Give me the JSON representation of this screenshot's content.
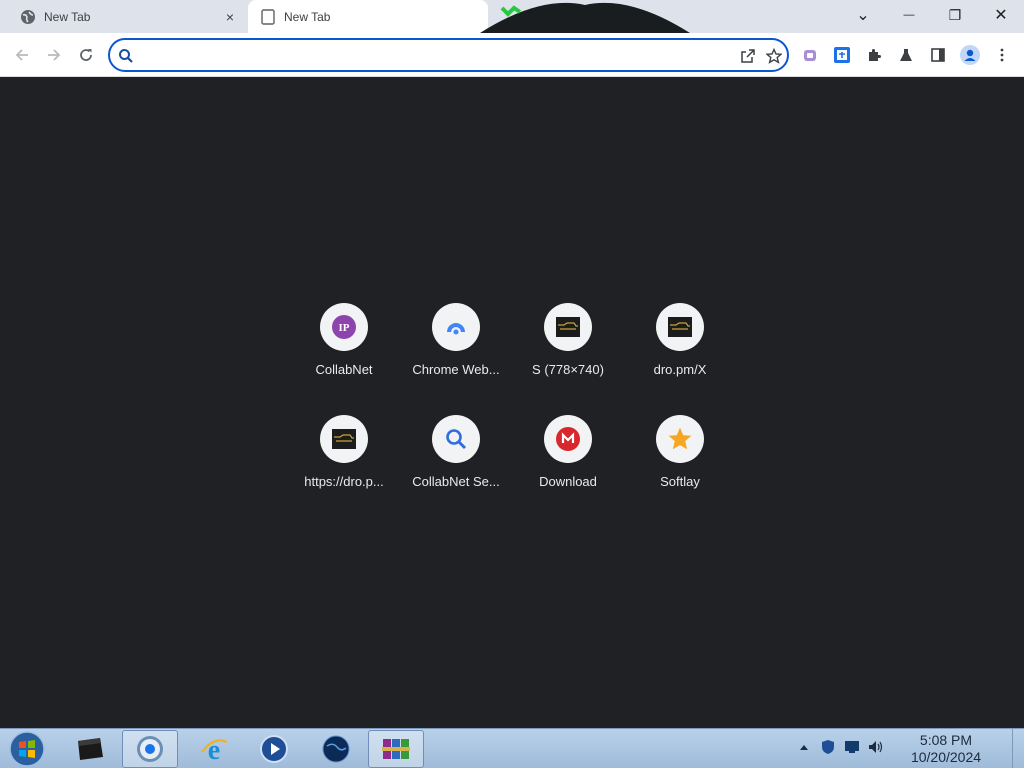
{
  "tabs": [
    {
      "title": "New Tab",
      "active": false
    },
    {
      "title": "New Tab",
      "active": true
    }
  ],
  "tab_close_glyph": "×",
  "window_controls": {
    "tab_search": "⌄",
    "minimize": "—",
    "restore": "❐",
    "close": "✕"
  },
  "omnibox": {
    "value": "",
    "placeholder": ""
  },
  "shortcuts": [
    {
      "label": "CollabNet",
      "icon": "ip-logo-icon"
    },
    {
      "label": "Chrome Web...",
      "icon": "chrome-webstore-icon"
    },
    {
      "label": "S (778×740)",
      "icon": "site-thumbnail-icon"
    },
    {
      "label": "dro.pm/X",
      "icon": "site-thumbnail-icon"
    },
    {
      "label": "https://dro.p...",
      "icon": "site-thumbnail-icon"
    },
    {
      "label": "CollabNet Se...",
      "icon": "search-icon"
    },
    {
      "label": "Download",
      "icon": "mega-icon"
    },
    {
      "label": "Softlay",
      "icon": "star-icon"
    }
  ],
  "taskbar": {
    "time": "5:08 PM",
    "date": "10/20/2024"
  },
  "colors": {
    "accent": "#0b57d0",
    "ntp_background": "#202124",
    "tabstrip": "#dee3eb",
    "ip_purple": "#8e44ad",
    "mega_red": "#d9272e",
    "star_orange": "#f5a623"
  }
}
